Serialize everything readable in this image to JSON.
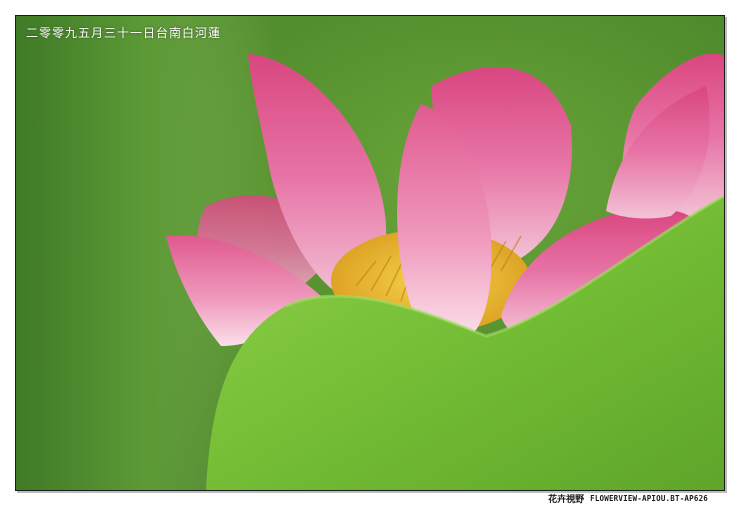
{
  "photo": {
    "caption": "二零零九五月三十一日台南白河蓮",
    "colors": {
      "background_green": "#5f9a35",
      "leaf_green": "#7cc23a",
      "petal_pink": "#e56aa0",
      "petal_light": "#f4b6cf",
      "stamen_yellow": "#f0c030"
    }
  },
  "footer": {
    "brand": "花卉視野",
    "site": "FLOWERVIEW-APIOU.BT-AP626"
  }
}
